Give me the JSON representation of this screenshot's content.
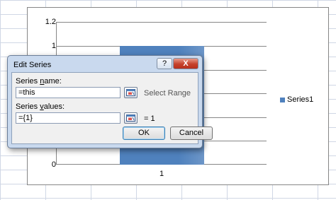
{
  "chart": {
    "y_ticks": [
      "1.2",
      "1",
      "0"
    ],
    "x_tick": "1",
    "legend": "Series1",
    "colors": {
      "bar": "#4f81bd"
    },
    "bar_value": 1
  },
  "dialog": {
    "title": "Edit Series",
    "help_symbol": "?",
    "close_symbol": "X",
    "series_name_label_pre": "Series ",
    "series_name_label_ul": "n",
    "series_name_label_post": "ame:",
    "series_name_value": "=this",
    "series_name_hint": "Select Range",
    "series_values_label_pre": "Series ",
    "series_values_label_ul": "v",
    "series_values_label_post": "alues:",
    "series_values_value": "={1}",
    "series_values_hint": "= 1",
    "ok_label": "OK",
    "cancel_label": "Cancel"
  }
}
